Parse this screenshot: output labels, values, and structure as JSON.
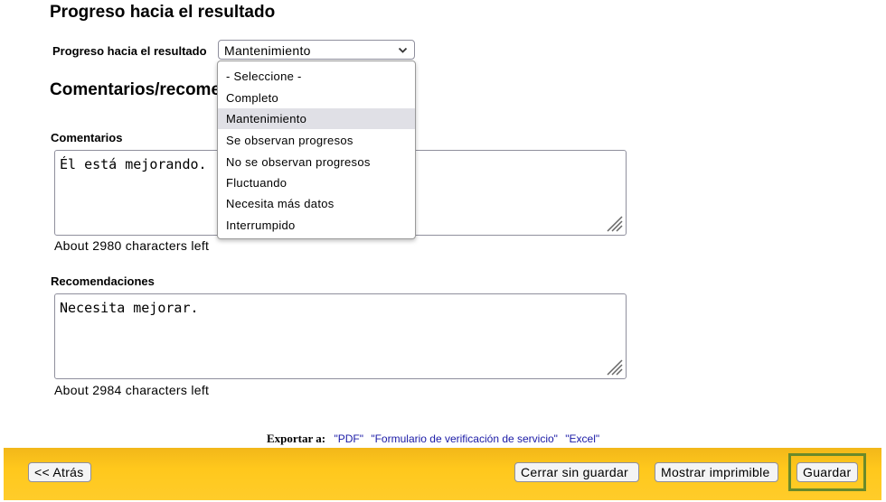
{
  "progress_section": {
    "title": "Progreso hacia el resultado",
    "field_label": "Progreso hacia el resultado",
    "selected_value": "Mantenimiento",
    "options": [
      "- Seleccione -",
      "Completo",
      "Mantenimiento",
      "Se observan progresos",
      "No se observan progresos",
      "Fluctuando",
      "Necesita más datos",
      "Interrumpido"
    ],
    "highlighted_option": "Mantenimiento"
  },
  "comments_section": {
    "title": "Comentarios/recomendaciones",
    "comments_label": "Comentarios",
    "comments_value": "Él está mejorando.",
    "comments_counter": "About 2980 characters left",
    "recommendations_label": "Recomendaciones",
    "recommendations_value": "Necesita mejorar.",
    "recommendations_counter": "About 2984 characters left"
  },
  "export": {
    "label": "Exportar a:",
    "links": [
      "\"PDF\"",
      "\"Formulario de verificación de servicio\"",
      "\"Excel\""
    ]
  },
  "footer": {
    "back_label": "<< Atrás",
    "close_label": "Cerrar sin guardar",
    "print_label": "Mostrar imprimible",
    "save_label": "Guardar"
  },
  "colors": {
    "footer_bar": "#ffc81c",
    "link": "#1a1aa6",
    "focus_ring": "#6a8a2a"
  }
}
